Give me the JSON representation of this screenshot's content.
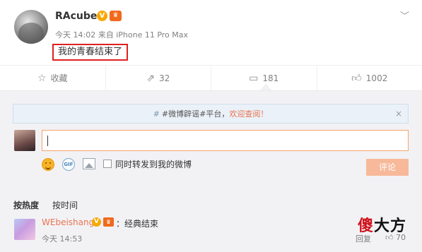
{
  "post": {
    "username": "RAcube",
    "v_badge": "V",
    "meta_time": "今天 14:02",
    "meta_from": "来自",
    "meta_device": "iPhone 11 Pro Max",
    "text": "我的青春结束了",
    "more_icon": "chevron-down-icon"
  },
  "actions": {
    "favorite_label": "收藏",
    "repost_count": "32",
    "comment_count": "181",
    "like_count": "1002"
  },
  "notice": {
    "hash_prefix": "#",
    "text": "#微博辟谣#平台，",
    "link": "欢迎查阅！",
    "close": "×"
  },
  "composer": {
    "input_value": "",
    "sync_label": "同时转发到我的微博",
    "submit_label": "评论",
    "gif_label": "GIF"
  },
  "sort": {
    "hot": "按热度",
    "time": "按时间"
  },
  "comment": {
    "username": "WEbeishang",
    "v_badge": "V",
    "text": "：经典结束",
    "time": "今天 14:53",
    "reply_label": "回复",
    "likes": "70"
  },
  "watermark": {
    "red": "傻",
    "black": "大方"
  },
  "colors": {
    "accent": "#eb7350",
    "highlight_border": "#e02020",
    "submit_disabled": "#f7b99a"
  }
}
